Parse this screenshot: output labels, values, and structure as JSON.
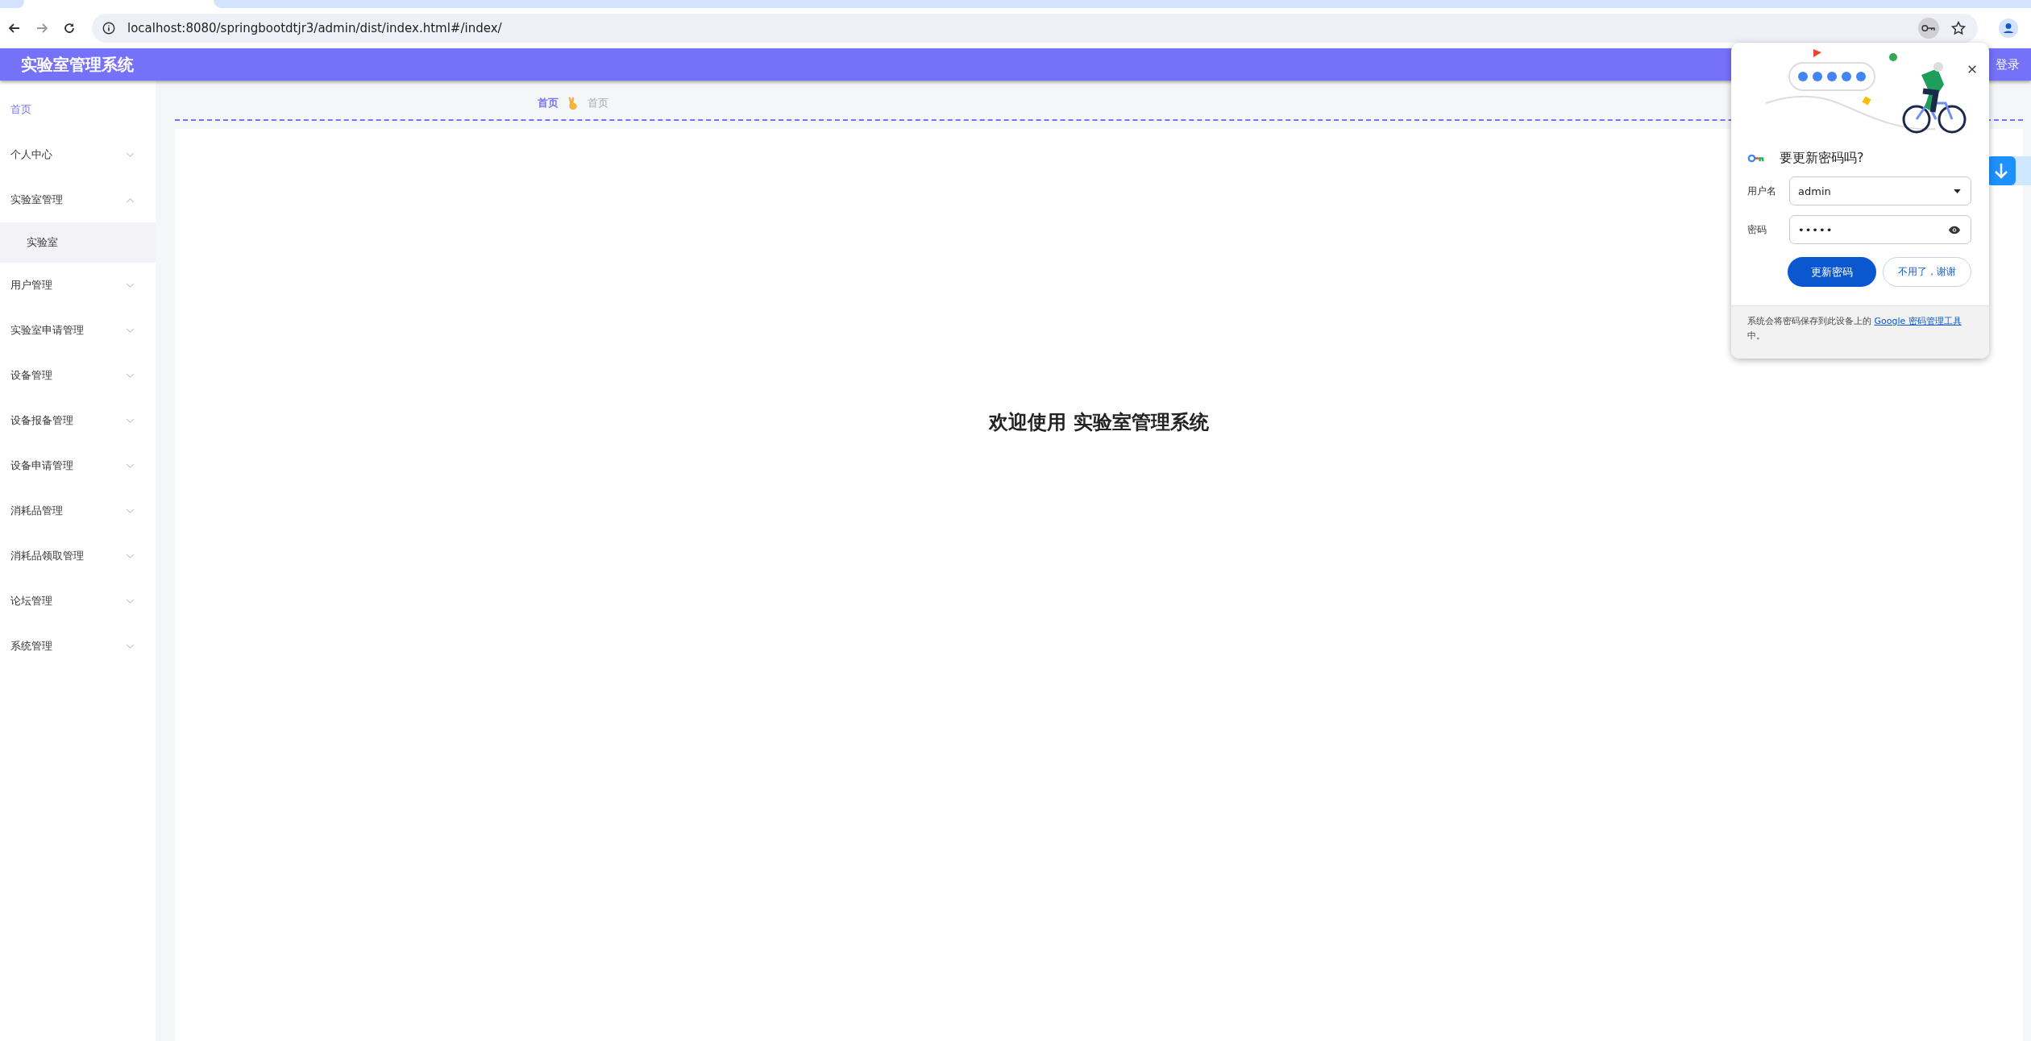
{
  "browser": {
    "url": "localhost:8080/springbootdtjr3/admin/dist/index.html#/index/"
  },
  "header": {
    "title": "实验室管理系统",
    "logout": "登录"
  },
  "sidebar": {
    "items": [
      {
        "label": "首页",
        "selected": true
      },
      {
        "label": "个人中心",
        "selected": false,
        "expanded": false
      },
      {
        "label": "实验室管理",
        "selected": false,
        "expanded": true,
        "children": [
          {
            "label": "实验室",
            "selected": false
          }
        ]
      },
      {
        "label": "用户管理",
        "selected": false,
        "expanded": false
      },
      {
        "label": "实验室申请管理",
        "selected": false,
        "expanded": false
      },
      {
        "label": "设备管理",
        "selected": false,
        "expanded": false
      },
      {
        "label": "设备报备管理",
        "selected": false,
        "expanded": false
      },
      {
        "label": "设备申请管理",
        "selected": false,
        "expanded": false
      },
      {
        "label": "消耗品管理",
        "selected": false,
        "expanded": false
      },
      {
        "label": "消耗品领取管理",
        "selected": false,
        "expanded": false
      },
      {
        "label": "论坛管理",
        "selected": false,
        "expanded": false
      },
      {
        "label": "系统管理",
        "selected": false,
        "expanded": false
      }
    ]
  },
  "breadcrumb": [
    {
      "label": "首页",
      "selected": true
    },
    {
      "label": "首页",
      "selected": false
    }
  ],
  "welcome": "欢迎使用 实验室管理系统",
  "password_popup": {
    "title": "要更新密码吗?",
    "username_label": "用户名",
    "username": "admin",
    "password_label": "密码",
    "password": "•••••",
    "primary_button": "更新密码",
    "secondary_button": "不用了，谢谢",
    "footer_text": "系统会将密码保存到此设备上的 ",
    "footer_link": "Google 密码管理工具",
    "footer_end": "中。"
  }
}
